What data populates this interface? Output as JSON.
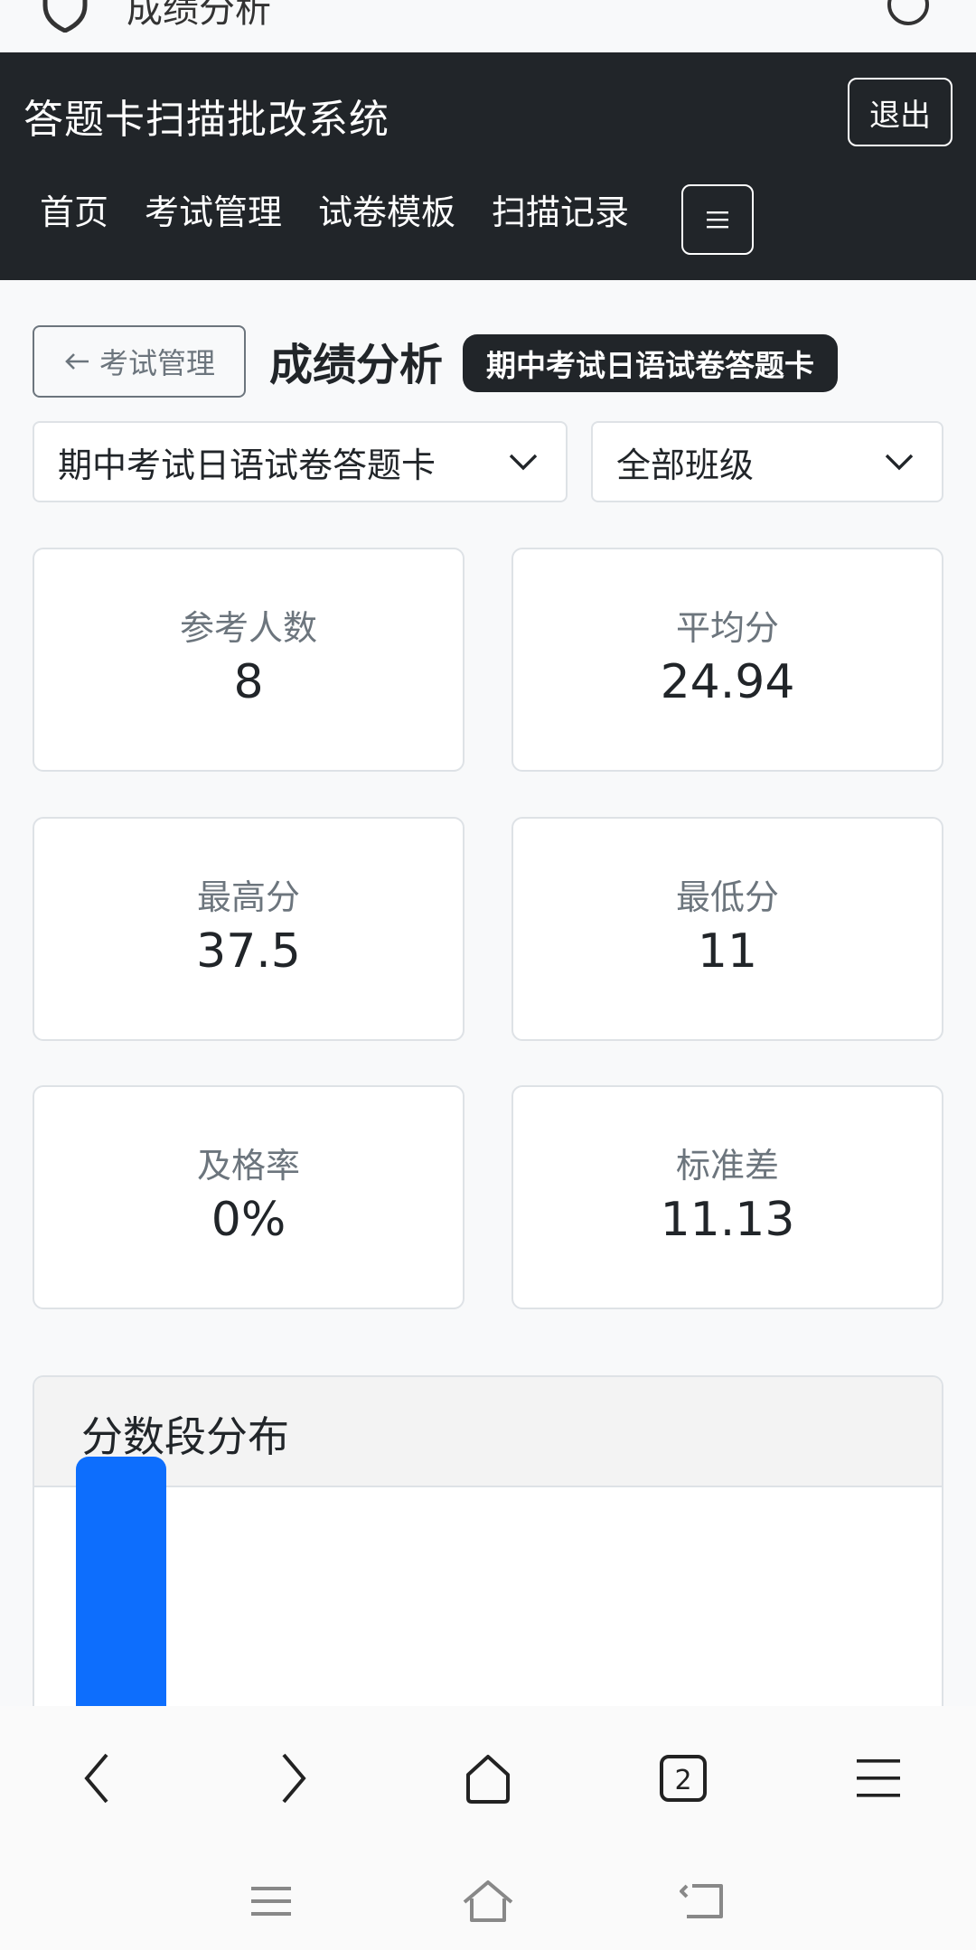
{
  "browser": {
    "page_title": "成绩分析",
    "tab_count": "2"
  },
  "navbar": {
    "brand": "答题卡扫描批改系统",
    "logout_label": "退出",
    "links": [
      {
        "label": "首页"
      },
      {
        "label": "考试管理"
      },
      {
        "label": "试卷模板"
      },
      {
        "label": "扫描记录"
      }
    ]
  },
  "header": {
    "back_label": "考试管理",
    "title": "成绩分析",
    "exam_badge": "期中考试日语试卷答题卡"
  },
  "filters": {
    "exam_selected": "期中考试日语试卷答题卡",
    "class_selected": "全部班级"
  },
  "stats": [
    {
      "label": "参考人数",
      "value": "8"
    },
    {
      "label": "平均分",
      "value": "24.94"
    },
    {
      "label": "最高分",
      "value": "37.5"
    },
    {
      "label": "最低分",
      "value": "11"
    },
    {
      "label": "及格率",
      "value": "0%"
    },
    {
      "label": "标准差",
      "value": "11.13"
    }
  ],
  "chart_section": {
    "title": "分数段分布"
  },
  "chart_data": {
    "type": "bar",
    "title": "分数段分布",
    "series": [
      {
        "values": [
          null
        ],
        "color": "#0d6efd"
      }
    ]
  },
  "colors": {
    "navbar_bg": "#212529",
    "bar": "#0d6efd",
    "page_bg": "#f8f9fa"
  }
}
